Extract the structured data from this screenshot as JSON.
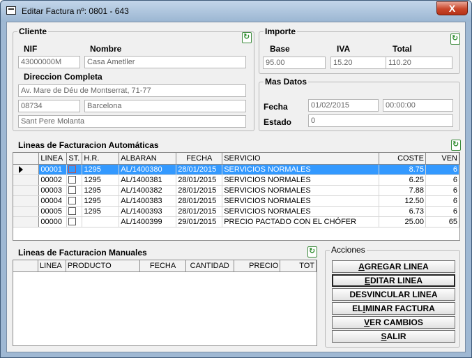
{
  "window": {
    "title": "Editar Factura nº: 0801 - 643",
    "close_label": "X"
  },
  "cliente": {
    "legend": "Cliente",
    "nif_label": "NIF",
    "nombre_label": "Nombre",
    "nif": "43000000M",
    "nombre": "Casa Ametller",
    "direccion_label": "Direccion Completa",
    "direccion": "Av. Mare de Déu de Montserrat, 71-77",
    "cp": "08734",
    "ciudad": "Barcelona",
    "poblacion": "Sant Pere Molanta"
  },
  "importe": {
    "legend": "Importe",
    "base_label": "Base",
    "iva_label": "IVA",
    "total_label": "Total",
    "base": "95.00",
    "iva": "15.20",
    "total": "110.20"
  },
  "mas_datos": {
    "legend": "Mas Datos",
    "fecha_label": "Fecha",
    "estado_label": "Estado",
    "fecha": "01/02/2015",
    "hora": "00:00:00",
    "estado": "0"
  },
  "auto": {
    "title": "Lineas de Facturacion Automáticas",
    "columns": [
      "LINEA",
      "ST.",
      "H.R.",
      "ALBARAN",
      "FECHA",
      "SERVICIO",
      "COSTE",
      "VEN"
    ],
    "rows": [
      {
        "linea": "00001",
        "hr": "1295",
        "albaran": "AL/1400380",
        "fecha": "28/01/2015",
        "servicio": "SERVICIOS NORMALES",
        "coste": "8.75",
        "ven": "6"
      },
      {
        "linea": "00002",
        "hr": "1295",
        "albaran": "AL/1400381",
        "fecha": "28/01/2015",
        "servicio": "SERVICIOS NORMALES",
        "coste": "6.25",
        "ven": "6"
      },
      {
        "linea": "00003",
        "hr": "1295",
        "albaran": "AL/1400382",
        "fecha": "28/01/2015",
        "servicio": "SERVICIOS NORMALES",
        "coste": "7.88",
        "ven": "6"
      },
      {
        "linea": "00004",
        "hr": "1295",
        "albaran": "AL/1400383",
        "fecha": "28/01/2015",
        "servicio": "SERVICIOS NORMALES",
        "coste": "12.50",
        "ven": "6"
      },
      {
        "linea": "00005",
        "hr": "1295",
        "albaran": "AL/1400393",
        "fecha": "28/01/2015",
        "servicio": "SERVICIOS NORMALES",
        "coste": "6.73",
        "ven": "6"
      },
      {
        "linea": "00000",
        "hr": "",
        "albaran": "AL/1400399",
        "fecha": "29/01/2015",
        "servicio": "PRECIO PACTADO CON EL CHÓFER",
        "coste": "25.00",
        "ven": "65"
      }
    ]
  },
  "manual": {
    "title": "Lineas de Facturacion Manuales",
    "columns": [
      "LINEA",
      "PRODUCTO",
      "FECHA",
      "CANTIDAD",
      "PRECIO",
      "TOT"
    ]
  },
  "acciones": {
    "legend": "Acciones",
    "buttons": {
      "agregar": {
        "u": "A",
        "rest": "GREGAR LINEA"
      },
      "editar": {
        "u": "E",
        "rest": "DITAR LINEA"
      },
      "desvincular": {
        "u": "",
        "rest": "DESVINCULAR LINEA"
      },
      "eliminar": {
        "pre": "EL",
        "u": "I",
        "rest": "MINAR FACTURA"
      },
      "vercambios": {
        "u": "V",
        "rest": "ER CAMBIOS"
      },
      "salir": {
        "u": "S",
        "rest": "ALIR"
      }
    }
  }
}
